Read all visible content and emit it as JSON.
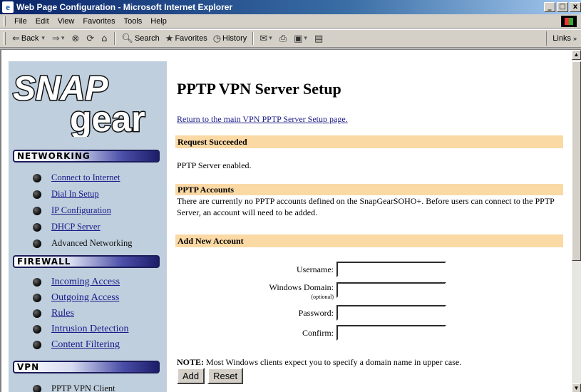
{
  "window": {
    "title": "Web Page Configuration - Microsoft Internet Explorer",
    "controls": {
      "minimize": "_",
      "maximize": "□",
      "close": "x"
    }
  },
  "menubar": {
    "items": [
      "File",
      "Edit",
      "View",
      "Favorites",
      "Tools",
      "Help"
    ]
  },
  "toolbar": {
    "back": "Back",
    "search": "Search",
    "favorites": "Favorites",
    "history": "History",
    "links": "Links"
  },
  "sidebar": {
    "logo_top": "SNAP",
    "logo_bottom": "gear",
    "sections": [
      {
        "title": "NETWORKING",
        "items": [
          "Connect to Internet",
          "Dial In Setup",
          "IP Configuration",
          "DHCP Server",
          "Advanced Networking"
        ]
      },
      {
        "title": "FIREWALL",
        "items": [
          "Incoming Access",
          "Outgoing Access",
          "Rules",
          "Intrusion Detection",
          "Content Filtering"
        ]
      },
      {
        "title": "VPN",
        "items": [
          "PPTP VPN Client"
        ]
      }
    ]
  },
  "main": {
    "heading": "PPTP VPN Server Setup",
    "return_link": "Return to the main VPN PPTP Server Setup page",
    "return_suffix": ".",
    "request_bar": "Request Succeeded",
    "request_text": "PPTP Server enabled.",
    "accounts_bar": "PPTP Accounts",
    "accounts_text": "There are currently no PPTP accounts defined on the SnapGearSOHO+. Before users can connect to the PPTP Server, an account will need to be added.",
    "add_bar": "Add New Account",
    "form": {
      "username_label": "Username:",
      "domain_label": "Windows Domain:",
      "domain_sub": "(optional)",
      "password_label": "Password:",
      "confirm_label": "Confirm:",
      "username_value": "",
      "domain_value": "",
      "password_value": "",
      "confirm_value": ""
    },
    "note_label": "NOTE:",
    "note_text": " Most Windows clients expect you to specify a domain name in upper case.",
    "add_button": "Add",
    "reset_button": "Reset"
  }
}
